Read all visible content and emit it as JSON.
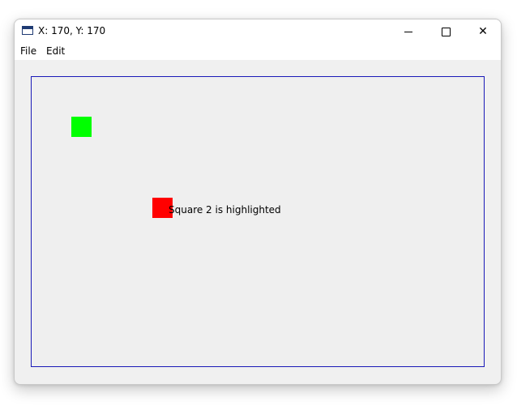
{
  "window": {
    "title": "X: 170, Y: 170"
  },
  "menu": {
    "items": [
      "File",
      "Edit"
    ]
  },
  "canvas": {
    "border_color": "#1a1ab8",
    "squares": [
      {
        "id": "square-1",
        "color": "#00ff00"
      },
      {
        "id": "square-2",
        "color": "#ff0000"
      }
    ],
    "status_text": "Square 2 is highlighted"
  },
  "icons": {
    "app": "window-app-icon",
    "minimize": "minimize-icon",
    "maximize": "maximize-icon",
    "close": "close-icon"
  }
}
